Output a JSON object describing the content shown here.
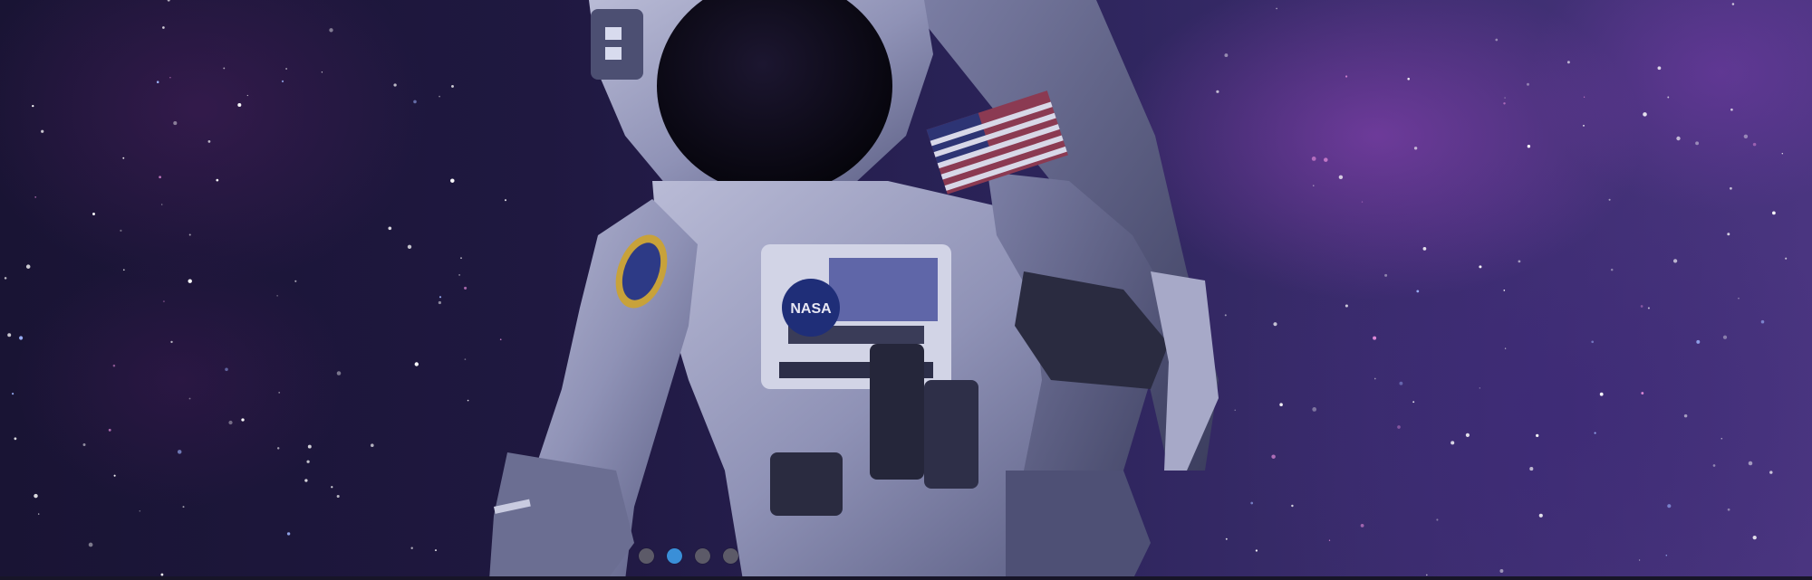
{
  "hero": {
    "image": {
      "subject": "astronaut-in-space"
    }
  },
  "carousel": {
    "slide_count": 4,
    "active_index": 1,
    "dots": [
      {
        "active": false
      },
      {
        "active": true
      },
      {
        "active": false
      },
      {
        "active": false
      }
    ],
    "colors": {
      "active_dot": "#3a8fd8",
      "inactive_dot": "#5c5a68"
    }
  }
}
